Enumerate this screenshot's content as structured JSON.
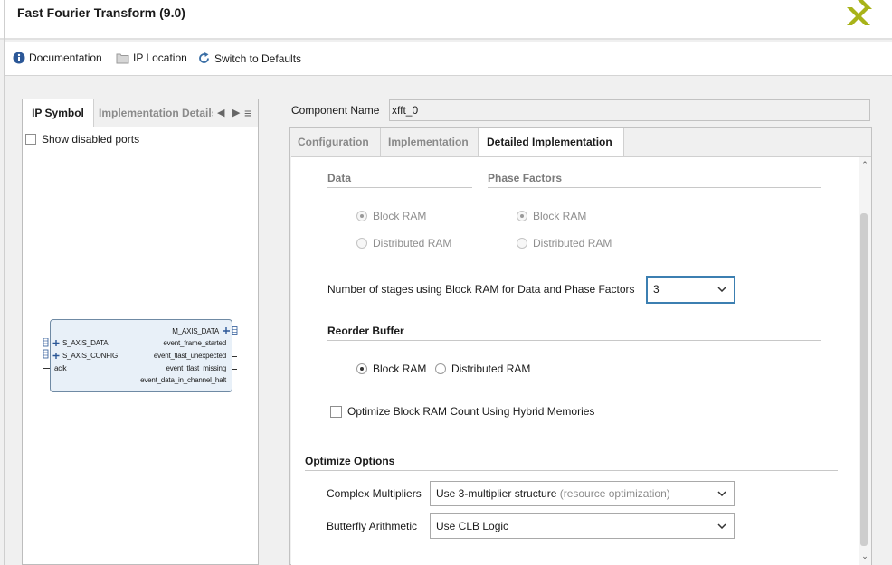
{
  "window": {
    "title": "Fast Fourier Transform (9.0)"
  },
  "toolbar": {
    "documentation": "Documentation",
    "ip_location": "IP Location",
    "switch_defaults": "Switch to Defaults"
  },
  "left_panel": {
    "tab_symbol": "IP Symbol",
    "tab_impl": "Implementation Details",
    "show_disabled": "Show disabled ports",
    "ip_block": {
      "left_ports": [
        "S_AXIS_DATA",
        "S_AXIS_CONFIG",
        "aclk"
      ],
      "right_ports": [
        "M_AXIS_DATA",
        "event_frame_started",
        "event_tlast_unexpected",
        "event_tlast_missing",
        "event_data_in_channel_halt"
      ]
    }
  },
  "component": {
    "label": "Component Name",
    "value": "xfft_0"
  },
  "tabs": [
    "Configuration",
    "Implementation",
    "Detailed Implementation"
  ],
  "detailed": {
    "data_heading": "Data",
    "phase_heading": "Phase Factors",
    "data_opts": [
      "Block RAM",
      "Distributed RAM"
    ],
    "phase_opts": [
      "Block RAM",
      "Distributed RAM"
    ],
    "stages_label": "Number of stages using Block RAM for Data and Phase Factors",
    "stages_value": "3",
    "reorder_heading": "Reorder Buffer",
    "reorder_opts": [
      "Block RAM",
      "Distributed RAM"
    ],
    "hybrid_label": "Optimize Block RAM Count Using Hybrid Memories",
    "optimize_heading": "Optimize Options",
    "complex_label": "Complex Multipliers",
    "complex_value": "Use 3-multiplier structure",
    "complex_hint": "(resource optimization)",
    "butterfly_label": "Butterfly Arithmetic",
    "butterfly_value": "Use CLB Logic"
  },
  "colors": {
    "info_icon": "#2b5797",
    "logo": "#a8b319",
    "refresh_icon": "#3a6ea5"
  }
}
